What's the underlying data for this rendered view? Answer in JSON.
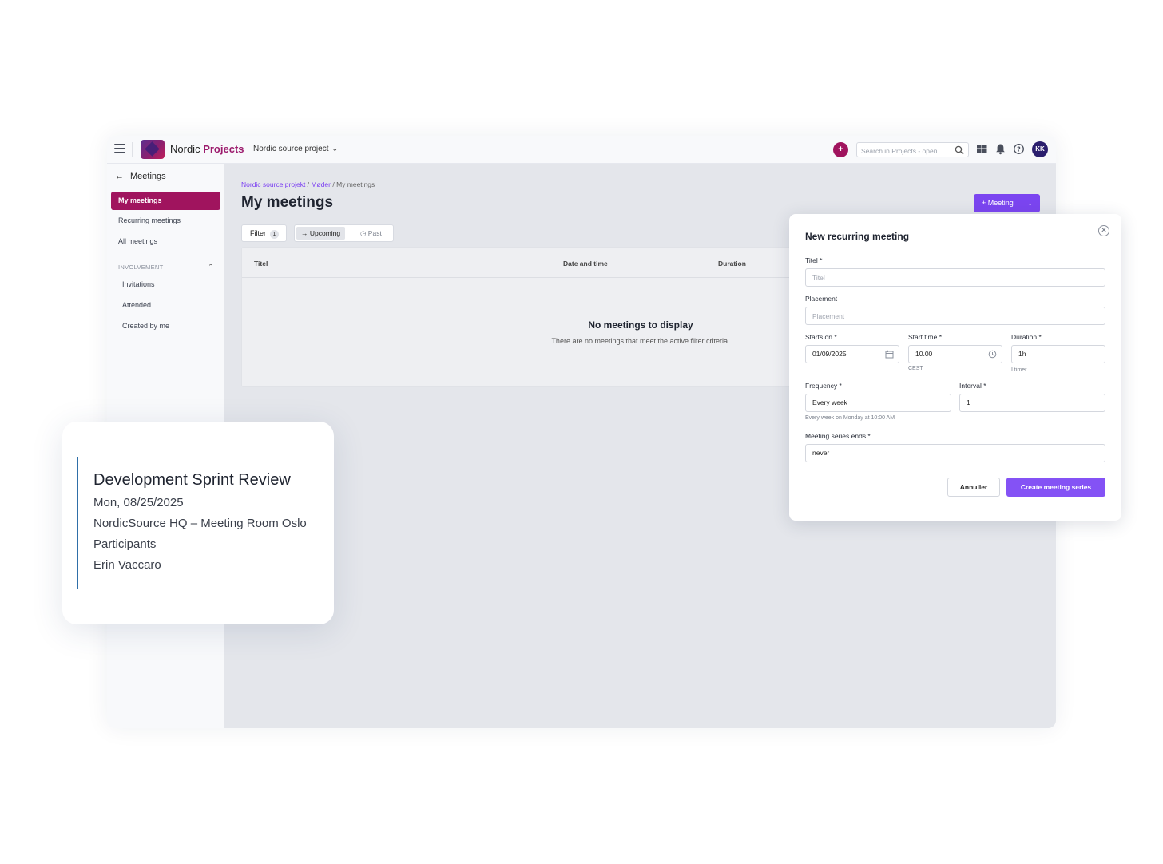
{
  "topbar": {
    "brand_prefix": "Nordic",
    "brand_suffix": "Projects",
    "project_selector": "Nordic source project",
    "plus": "+",
    "search_placeholder": "Search in Projects - open...",
    "avatar_initials": "KK"
  },
  "sidebar": {
    "back_label": "Meetings",
    "items": [
      {
        "label": "My meetings",
        "active": true
      },
      {
        "label": "Recurring meetings"
      },
      {
        "label": "All meetings"
      }
    ],
    "section": "INVOLVEMENT",
    "sub_items": [
      "Invitations",
      "Attended",
      "Created by me"
    ]
  },
  "main": {
    "breadcrumb": {
      "project": "Nordic source projekt",
      "sep": " / ",
      "section": "Møder",
      "current": "My meetings"
    },
    "title": "My meetings",
    "meeting_button": "+  Meeting",
    "filter_label": "Filter",
    "filter_count": "1",
    "segments": {
      "upcoming": "Upcoming",
      "past": "Past"
    },
    "table": {
      "columns": [
        "Titel",
        "Date and time",
        "Duration"
      ],
      "empty_title": "No meetings to display",
      "empty_sub": "There are no meetings that meet the active filter criteria."
    }
  },
  "modal": {
    "title": "New recurring meeting",
    "titel_label": "Titel *",
    "titel_placeholder": "Titel",
    "placement_label": "Placement",
    "placement_placeholder": "Placement",
    "starts_on_label": "Starts on *",
    "starts_on_value": "01/09/2025",
    "start_time_label": "Start time *",
    "start_time_value": "10.00",
    "timezone": "CEST",
    "duration_label": "Duration *",
    "duration_value": "1h",
    "duration_hint": "I timer",
    "frequency_label": "Frequency *",
    "frequency_value": "Every week",
    "frequency_hint": "Every week on Monday at 10:00 AM",
    "interval_label": "Interval *",
    "interval_value": "1",
    "ends_label": "Meeting series ends *",
    "ends_value": "never",
    "cancel_label": "Annuller",
    "create_label": "Create meeting series"
  },
  "card": {
    "title": "Development Sprint Review",
    "date": "Mon, 08/25/2025",
    "location": "NordicSource HQ – Meeting Room Oslo",
    "participants_label": "Participants",
    "participant": "Erin Vaccaro"
  },
  "colors": {
    "accent_magenta": "#a0145e",
    "accent_purple": "#7b45f0",
    "card_bar": "#2f6fa8"
  }
}
